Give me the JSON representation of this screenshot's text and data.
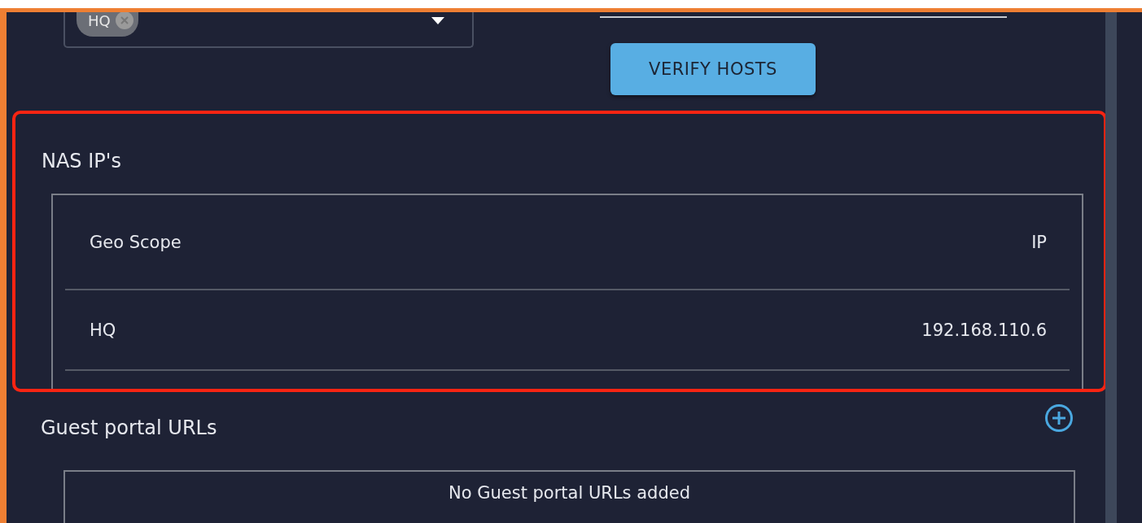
{
  "geo_select": {
    "chips": [
      {
        "label": "HQ",
        "removable": true
      }
    ]
  },
  "verify_button": {
    "label": "VERIFY HOSTS"
  },
  "nas_section": {
    "title": "NAS IP's",
    "highlighted": true,
    "table": {
      "columns": [
        "Geo Scope",
        "IP"
      ],
      "rows": [
        {
          "geo_scope": "HQ",
          "ip": "192.168.110.6"
        }
      ]
    }
  },
  "guest_section": {
    "title": "Guest portal URLs",
    "empty_text": "No Guest portal URLs added"
  }
}
